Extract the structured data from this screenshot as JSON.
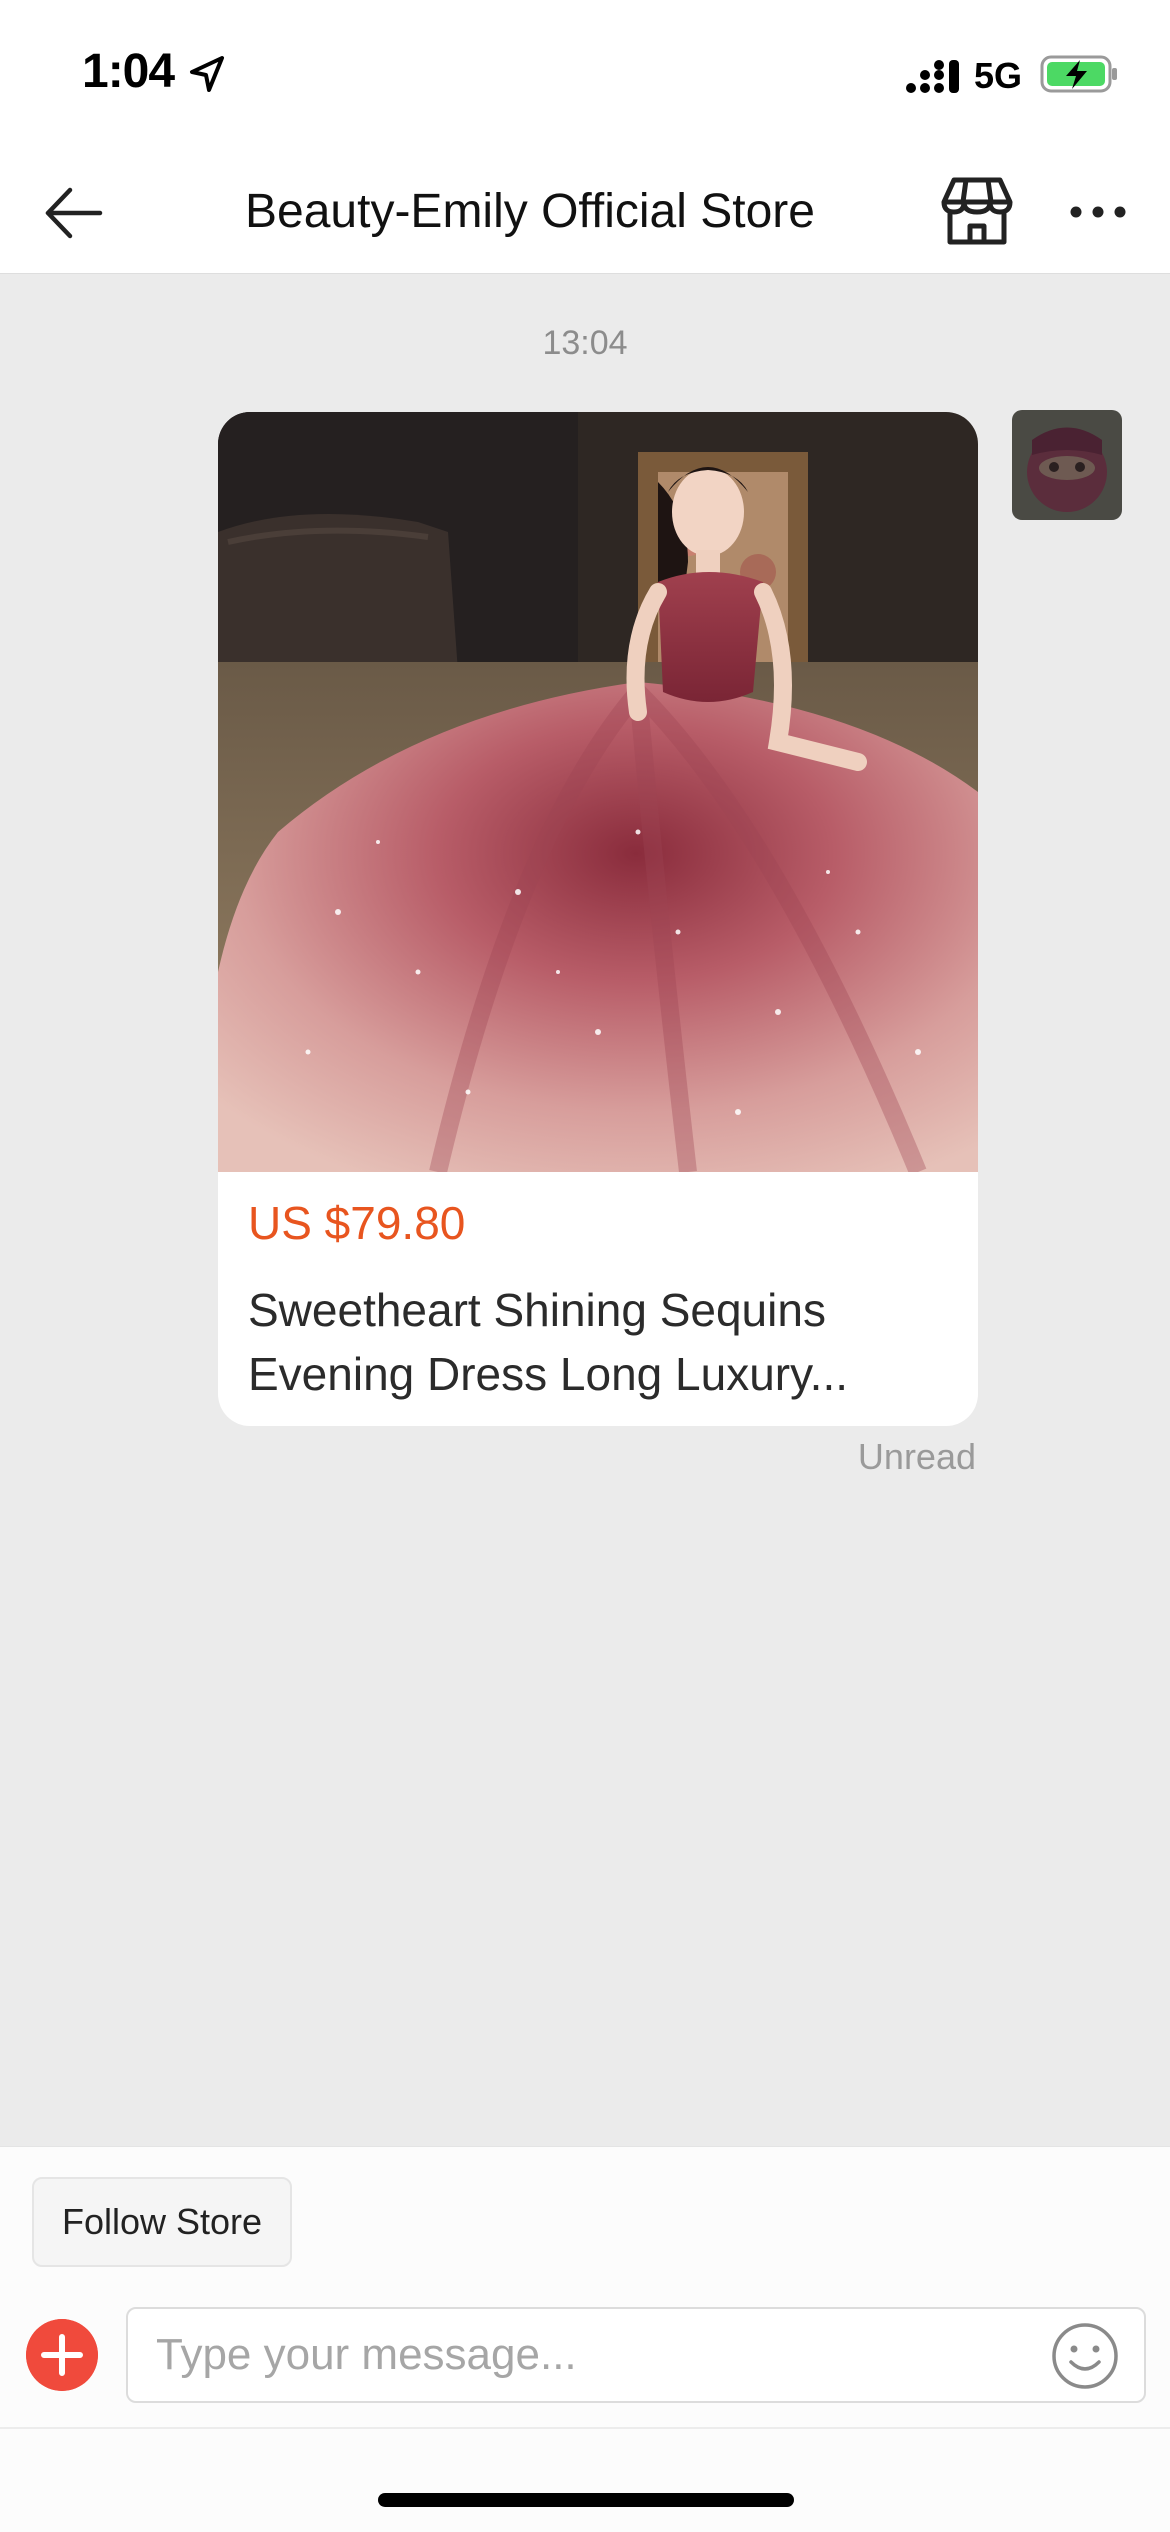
{
  "status_bar": {
    "time": "1:04",
    "network": "5G"
  },
  "header": {
    "title": "Beauty-Emily Official Store",
    "icons": [
      "back-arrow-icon",
      "store-icon",
      "more-icon"
    ]
  },
  "chat": {
    "timestamp": "13:04",
    "product": {
      "price": "US $79.80",
      "name": "Sweetheart Shining Sequins Evening Dress Long Luxury..."
    },
    "read_status": "Unread"
  },
  "footer": {
    "follow_label": "Follow Store",
    "input_placeholder": "Type your message...",
    "icons": [
      "plus-icon",
      "emoji-icon"
    ]
  },
  "colors": {
    "accent_price": "#e8551f",
    "add_button": "#f04a3c",
    "battery_fill": "#4cd964",
    "chat_background": "#ebebeb"
  }
}
